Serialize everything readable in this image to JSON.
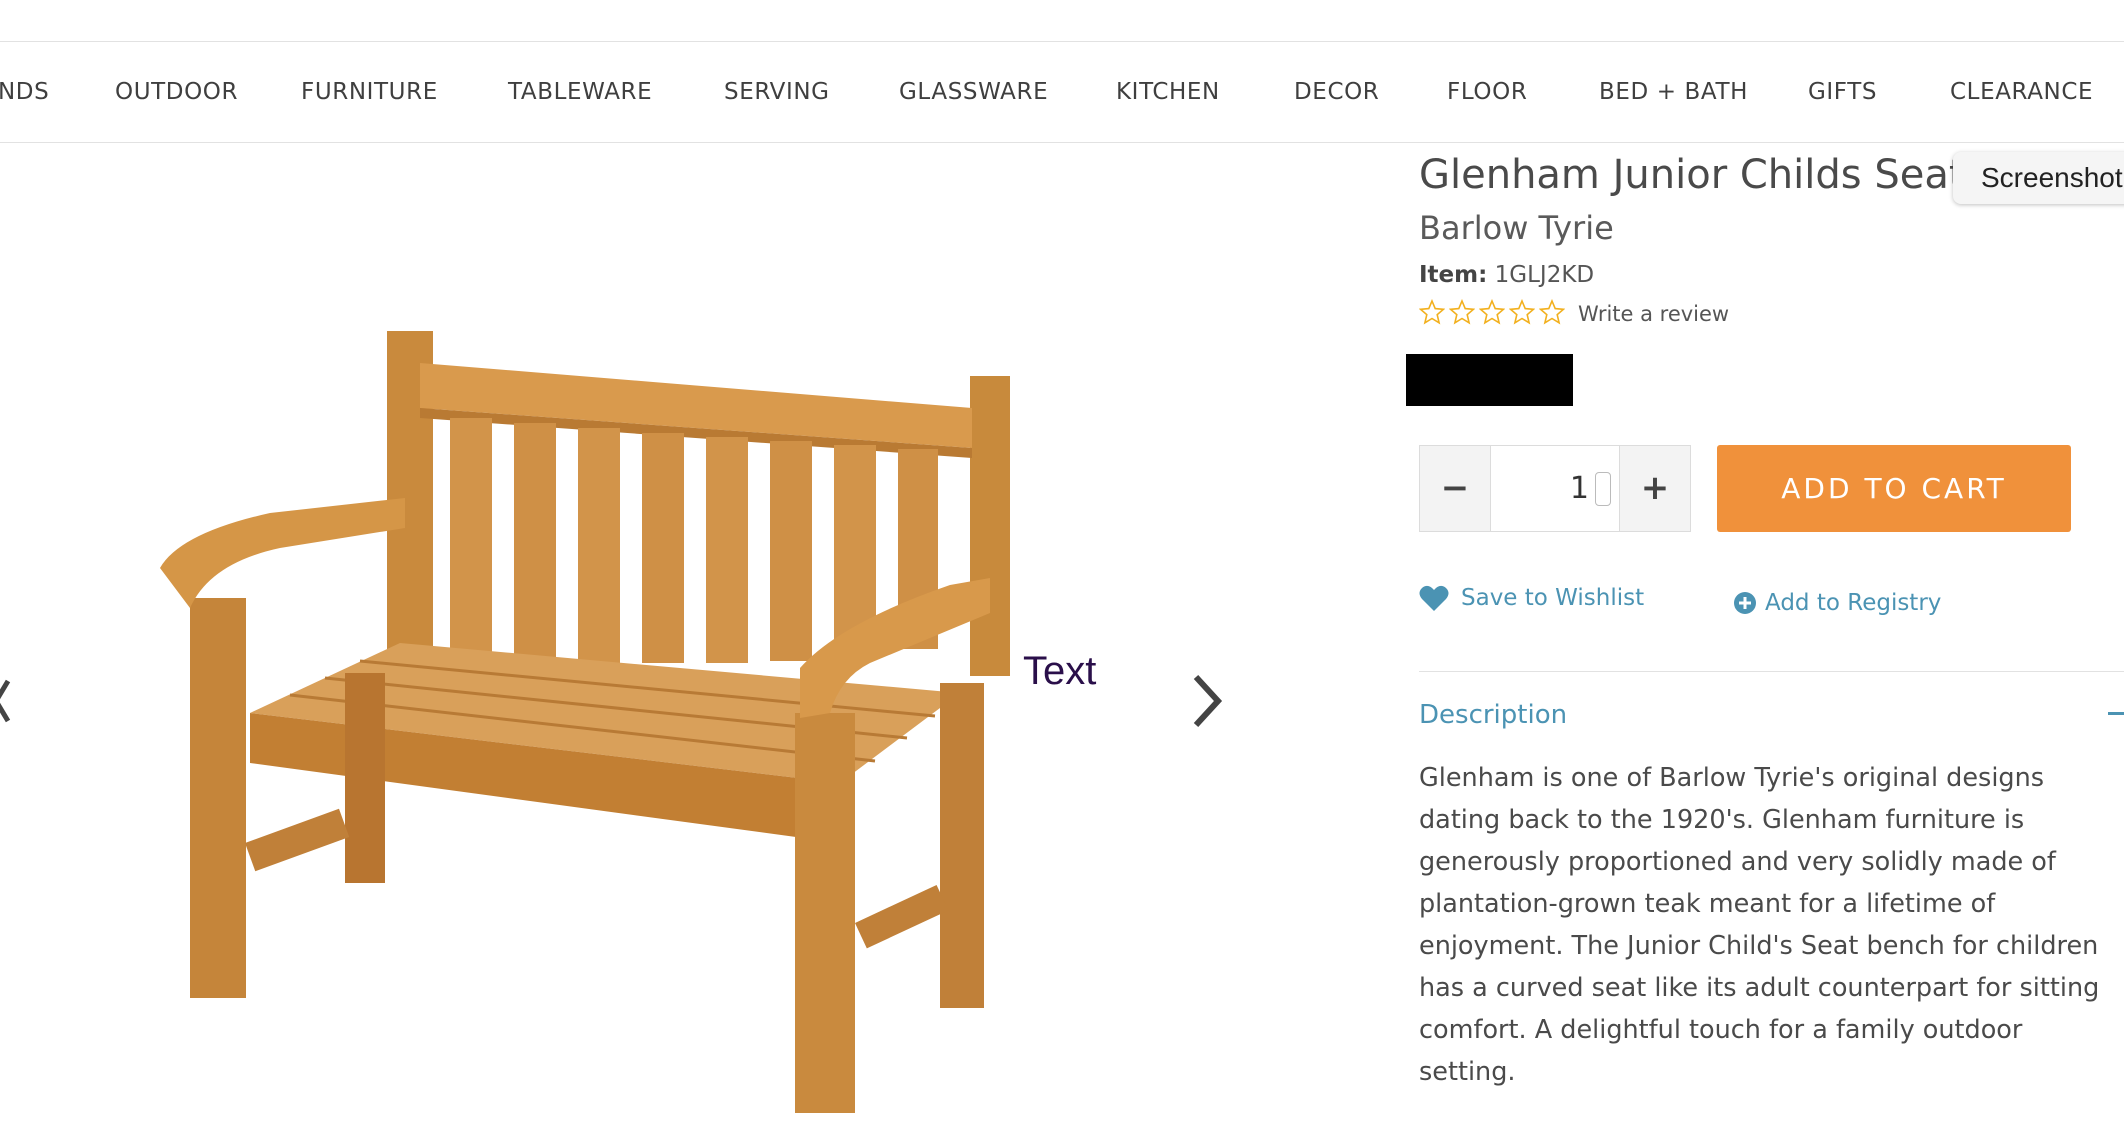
{
  "nav": {
    "items": [
      "NDS",
      "OUTDOOR",
      "FURNITURE",
      "TABLEWARE",
      "SERVING",
      "GLASSWARE",
      "KITCHEN",
      "DECOR",
      "FLOOR",
      "BED + BATH",
      "GIFTS",
      "CLEARANCE"
    ]
  },
  "gallery": {
    "overlay_text": "Text",
    "prev_icon": "chevron-left-icon",
    "next_icon": "chevron-right-icon"
  },
  "product": {
    "title": "Glenham Junior Childs Seat",
    "brand": "Barlow Tyrie",
    "item_label": "Item:",
    "item_number": "1GLJ2KD",
    "rating": 0,
    "rating_max": 5,
    "review_link": "Write a review",
    "quantity": "1",
    "qty_minus": "−",
    "qty_plus": "+",
    "add_to_cart": "ADD TO CART",
    "wishlist": "Save to Wishlist",
    "registry": "Add to Registry",
    "description_heading": "Description",
    "description": "Glenham is one of Barlow Tyrie's original designs dating back to the 1920's. Glenham furniture is generously proportioned and very solidly made of plantation-grown teak meant for a lifetime of enjoyment. The Junior Child's Seat bench for children has a curved seat like its adult counterpart for sitting comfort. A delightful touch for a family outdoor setting."
  },
  "screenshot_button": "Screenshot",
  "colors": {
    "accent_orange": "#f0913b",
    "link_blue": "#4b93b3",
    "star_gold": "#f2b01e"
  }
}
